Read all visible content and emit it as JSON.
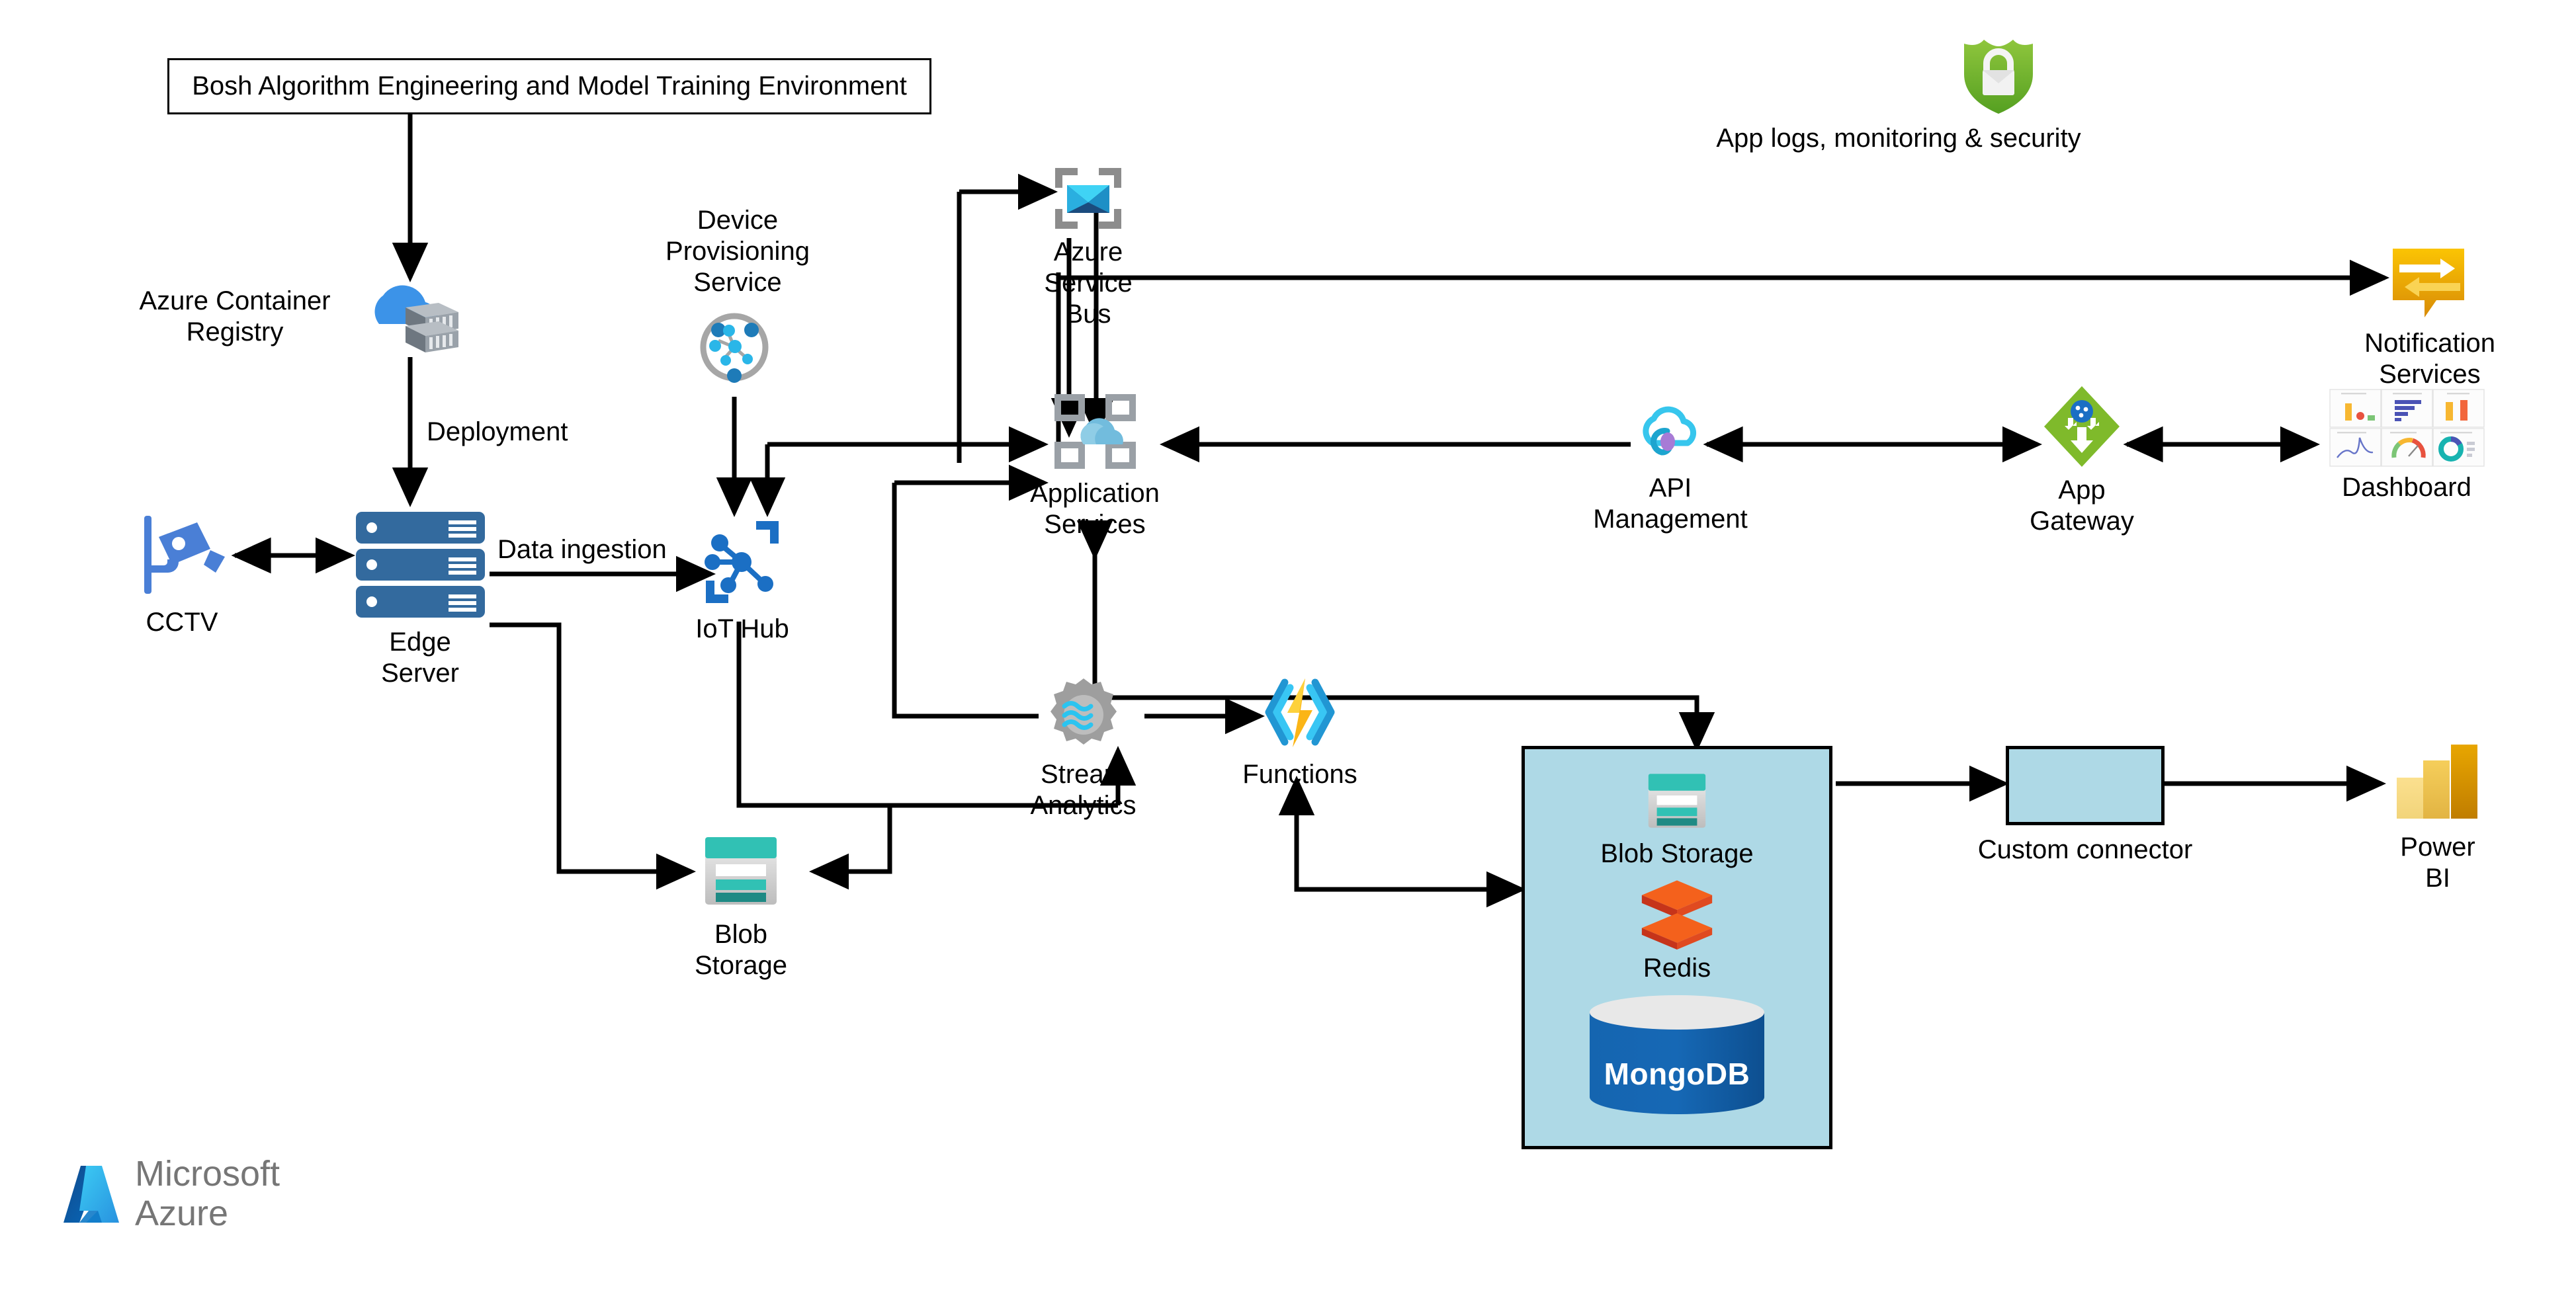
{
  "diagram": {
    "title_box": {
      "text": "Bosh Algorithm Engineering and Model Training Environment"
    },
    "nodes": [
      {
        "id": "acr",
        "label": "Azure Container\nRegistry",
        "icon": "azure-container-registry-icon"
      },
      {
        "id": "cctv",
        "label": "CCTV",
        "icon": "cctv-camera-icon"
      },
      {
        "id": "edge",
        "label": "Edge Server",
        "icon": "server-stack-icon"
      },
      {
        "id": "dps",
        "label": "Device\nProvisioning\nService",
        "icon": "device-provisioning-service-icon"
      },
      {
        "id": "iothub",
        "label": "IoT Hub",
        "icon": "iot-hub-icon"
      },
      {
        "id": "servicebus",
        "label": "Azure Service Bus",
        "icon": "azure-service-bus-icon"
      },
      {
        "id": "appsvc",
        "label": "Application Services",
        "icon": "application-services-icon"
      },
      {
        "id": "apim",
        "label": "API Management",
        "icon": "api-management-icon"
      },
      {
        "id": "appgw",
        "label": "App Gateway",
        "icon": "app-gateway-icon"
      },
      {
        "id": "dashboard",
        "label": "Dashboard",
        "icon": "dashboard-icon"
      },
      {
        "id": "notify",
        "label": "Notification\nServices",
        "icon": "notification-services-icon"
      },
      {
        "id": "security",
        "label": "App logs, monitoring & security",
        "icon": "shield-lock-icon"
      },
      {
        "id": "stream",
        "label": "Stream\nAnalytics",
        "icon": "stream-analytics-icon"
      },
      {
        "id": "functions",
        "label": "Functions",
        "icon": "azure-functions-icon"
      },
      {
        "id": "blob1",
        "label": "Blob Storage",
        "icon": "blob-storage-icon"
      },
      {
        "id": "connector",
        "label": "Custom connector",
        "icon": "custom-connector-box"
      },
      {
        "id": "powerbi",
        "label": "Power BI",
        "icon": "power-bi-icon"
      }
    ],
    "data_group": {
      "items": [
        {
          "id": "blob2",
          "label": "Blob Storage",
          "icon": "blob-storage-icon"
        },
        {
          "id": "redis",
          "label": "Redis",
          "icon": "redis-icon"
        },
        {
          "id": "mongodb",
          "label": "MongoDB",
          "icon": "mongodb-cylinder-icon"
        }
      ]
    },
    "edge_labels": [
      {
        "id": "deployment",
        "text": "Deployment"
      },
      {
        "id": "data-ingestion",
        "text": "Data ingestion"
      }
    ],
    "brand": {
      "line1": "Microsoft",
      "line2": "Azure"
    },
    "colors": {
      "accent_blue": "#0078D4",
      "group_fill": "#AED9E6",
      "wire": "#000000",
      "teal": "#31C1B4",
      "redis_orange": "#F05A28",
      "mongo_blue": "#0B5FA5",
      "security_green": "#7AB800",
      "notify_yellow": "#F2B705",
      "brand_gray": "#767676"
    }
  }
}
